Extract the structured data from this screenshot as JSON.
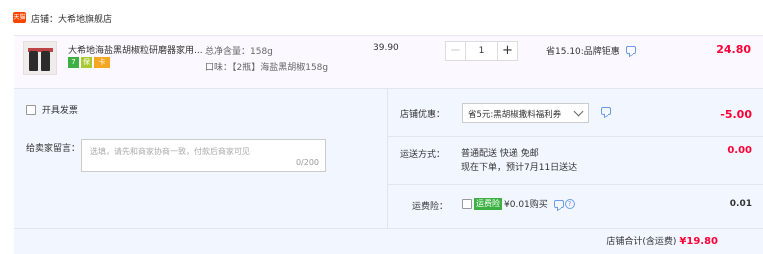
{
  "shop": {
    "icon_text": "天猫",
    "label": "店铺：大希地旗舰店"
  },
  "item": {
    "title": "大希地海盐黑胡椒粒研磨器家用...",
    "sku_weight": "总净含量：158g",
    "sku_flavor": "口味：【2瓶】海盐黑胡椒158g",
    "unit_price": "39.90",
    "quantity": "1",
    "minus_label": "−",
    "plus_label": "+",
    "savings": "省15.10:品牌钜惠",
    "subtotal": "24.80",
    "badges": [
      "7",
      "保",
      "卡"
    ]
  },
  "options": {
    "invoice_label": "开具发票",
    "message_label": "给卖家留言：",
    "message_placeholder": "选填，请先和商家协商一致，付款后商家可见",
    "message_counter": "0/200",
    "coupon_label": "店铺优惠：",
    "coupon_value": "省5元:黑胡椒撒料福利券",
    "coupon_discount": "-5.00",
    "shipping_label": "运送方式：",
    "shipping_line1": "普通配送 快递 免邮",
    "shipping_line2": "现在下单，预计7月11日送达",
    "shipping_price": "0.00",
    "insurance_label": "运费险：",
    "insurance_badge": "运费险",
    "insurance_text": "¥0.01购买",
    "insurance_price": "0.01",
    "help_glyph": "?"
  },
  "total": {
    "label": "店铺合计(含运费)",
    "amount": "¥19.80"
  },
  "colors": {
    "accent_red": "#ff0036",
    "brand_orange": "#ff4400",
    "panel_bg": "#f2f7ff",
    "item_bg": "#fbf9ff",
    "link_blue": "#6b9be6"
  }
}
